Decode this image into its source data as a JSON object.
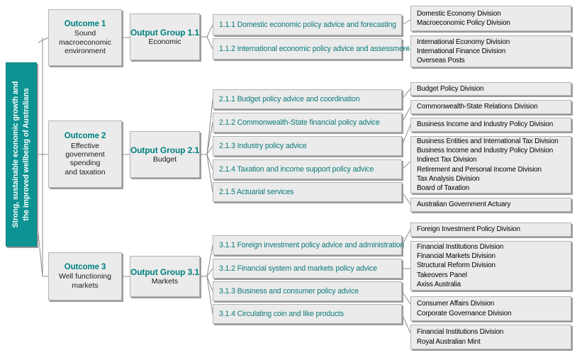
{
  "banner": {
    "line1": "Strong, sustainable economic growth and",
    "line2": "the improved wellbeing of Australians"
  },
  "outcomes": [
    {
      "title": "Outcome 1",
      "sub_lines": [
        "Sound",
        "macroeconomic",
        "environment"
      ],
      "group": {
        "title": "Output Group 1.1",
        "sub_lines": [
          "Economic"
        ]
      },
      "outputs": [
        {
          "label": "1.1.1 Domestic economic policy advice and forecasting",
          "divisions": [
            "Domestic Economy Division",
            "Macroeconomic Policy Division"
          ]
        },
        {
          "label": "1.1.2 International economic policy advice and assessment",
          "divisions": [
            "International Economy Division",
            "International Finance Division",
            "Overseas Posts"
          ]
        }
      ]
    },
    {
      "title": "Outcome 2",
      "sub_lines": [
        "Effective",
        "government",
        "spending",
        "and taxation"
      ],
      "group": {
        "title": "Output Group 2.1",
        "sub_lines": [
          "Budget"
        ]
      },
      "outputs": [
        {
          "label": "2.1.1 Budget policy advice and coordination",
          "divisions": [
            "Budget Policy Division"
          ]
        },
        {
          "label": "2.1.2 Commonwealth-State financial policy advice",
          "divisions": [
            "Commonwealth-State Relations Division"
          ]
        },
        {
          "label": "2.1.3 Industry policy advice",
          "divisions": [
            "Business Income and Industry Policy Division"
          ]
        },
        {
          "label": "2.1.4 Taxation and income support policy advice",
          "divisions": [
            "Business Entities and International Tax Division",
            "Business Income and Industry Policy Division",
            "Indirect Tax Division",
            "Retirement and Personal Income Division",
            "Tax Analysis Division",
            "Board of Taxation"
          ]
        },
        {
          "label": "2.1.5 Actuarial services",
          "divisions": [
            "Australian Government Actuary"
          ]
        }
      ]
    },
    {
      "title": "Outcome 3",
      "sub_lines": [
        "Well functioning",
        "markets"
      ],
      "group": {
        "title": "Output Group 3.1",
        "sub_lines": [
          "Markets"
        ]
      },
      "outputs": [
        {
          "label": "3.1.1 Foreign investment policy advice and administration",
          "divisions": [
            "Foreign Investment Policy Division"
          ]
        },
        {
          "label": "3.1.2 Financial system and markets policy advice",
          "divisions": [
            "Financial Institutions Division",
            "Financial Markets Division",
            "Structural Reform Division",
            "Takeovers Panel",
            "Axiss Australia"
          ]
        },
        {
          "label": "3.1.3 Business and consumer policy advice",
          "divisions": [
            "Consumer Affairs Division",
            "Corporate Governance Division"
          ]
        },
        {
          "label": "3.1.4 Circulating coin and like products",
          "divisions": [
            "Financial Institutions Division",
            "Royal Australian Mint"
          ]
        }
      ]
    }
  ],
  "colors": {
    "teal_banner": "#0d9393",
    "teal_text": "#008080",
    "box_fill": "#ebebeb",
    "box_border": "#b4b4b4",
    "connector": "#8a8a8a"
  }
}
